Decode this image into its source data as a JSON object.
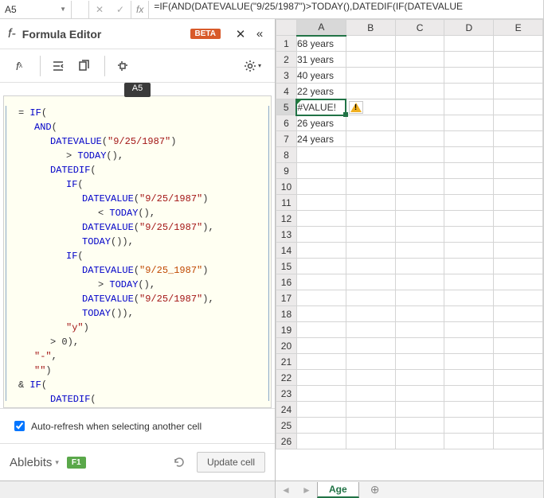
{
  "formula_bar": {
    "cell_ref": "A5",
    "fx_label": "fx",
    "formula": "=IF(AND(DATEVALUE(\"9/25/1987\")>TODAY(),DATEDIF(IF(DATEVALUE"
  },
  "editor": {
    "fx_prefix": "f-",
    "title": "Formula Editor",
    "beta": "BETA",
    "cell_tag": "A5",
    "auto_refresh_label": "Auto-refresh when selecting another cell",
    "brand": "Ablebits",
    "help_key": "F1",
    "update_btn": "Update cell",
    "code": {
      "eq": "= ",
      "if": "IF",
      "and": "AND",
      "datevalue": "DATEVALUE",
      "today": "TODAY",
      "datedif": "DATEDIF",
      "amp": "& ",
      "d1": "\"9/25/1987\"",
      "d2": "\"9/25_1987\"",
      "gt": "> ",
      "lt": "< ",
      "num0": "0",
      "y": "\"y\"",
      "dash": "\"-\"",
      "empty": "\"\"",
      "open": "(",
      "close": ")",
      "comma": ","
    }
  },
  "grid": {
    "cols": [
      "A",
      "B",
      "C",
      "D",
      "E"
    ],
    "rows": [
      {
        "n": 1,
        "a": "68 years"
      },
      {
        "n": 2,
        "a": "31 years"
      },
      {
        "n": 3,
        "a": "40 years"
      },
      {
        "n": 4,
        "a": "22 years"
      },
      {
        "n": 5,
        "a": "#VALUE!",
        "err": true,
        "sel": true
      },
      {
        "n": 6,
        "a": "26 years"
      },
      {
        "n": 7,
        "a": "24 years"
      },
      {
        "n": 8,
        "a": ""
      },
      {
        "n": 9,
        "a": ""
      },
      {
        "n": 10,
        "a": ""
      },
      {
        "n": 11,
        "a": ""
      },
      {
        "n": 12,
        "a": ""
      },
      {
        "n": 13,
        "a": ""
      },
      {
        "n": 14,
        "a": ""
      },
      {
        "n": 15,
        "a": ""
      },
      {
        "n": 16,
        "a": ""
      },
      {
        "n": 17,
        "a": ""
      },
      {
        "n": 18,
        "a": ""
      },
      {
        "n": 19,
        "a": ""
      },
      {
        "n": 20,
        "a": ""
      },
      {
        "n": 21,
        "a": ""
      },
      {
        "n": 22,
        "a": ""
      },
      {
        "n": 23,
        "a": ""
      },
      {
        "n": 24,
        "a": ""
      },
      {
        "n": 25,
        "a": ""
      },
      {
        "n": 26,
        "a": ""
      }
    ],
    "tab_name": "Age"
  }
}
